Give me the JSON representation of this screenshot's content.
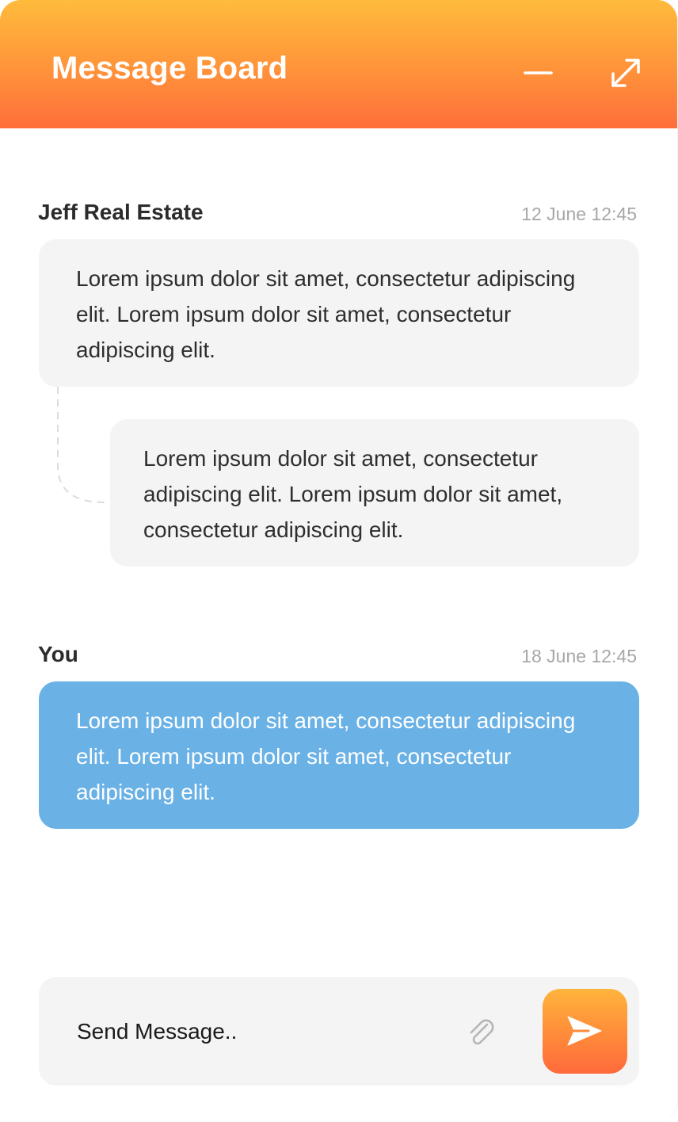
{
  "window": {
    "title": "Message Board",
    "accent_gradient": [
      "#ffbb3c",
      "#ff6e3b"
    ],
    "controls": [
      {
        "name": "minimize",
        "icon": "minimize-icon"
      },
      {
        "name": "expand",
        "icon": "expand-icon"
      }
    ]
  },
  "messages": [
    {
      "sender": "Jeff Real Estate",
      "timestamp": "12 June 12:45",
      "text": "Lorem ipsum dolor sit amet, consectetur adipiscing elit. Lorem ipsum dolor sit amet, consectetur adipiscing elit.",
      "replies": [
        {
          "text": "Lorem ipsum dolor sit amet, consectetur adipiscing elit. Lorem ipsum dolor sit amet, consectetur adipiscing elit."
        }
      ],
      "bubble_color": "#f4f4f4"
    },
    {
      "sender": "You",
      "timestamp": "18 June 12:45",
      "text": "Lorem ipsum dolor sit amet, consectetur adipiscing elit. Lorem ipsum dolor sit amet, consectetur adipiscing elit.",
      "bubble_color": "#6ab1e6"
    }
  ],
  "composer": {
    "placeholder": "Send Message..",
    "attach_icon": "paperclip-icon",
    "send_icon": "send-icon"
  }
}
